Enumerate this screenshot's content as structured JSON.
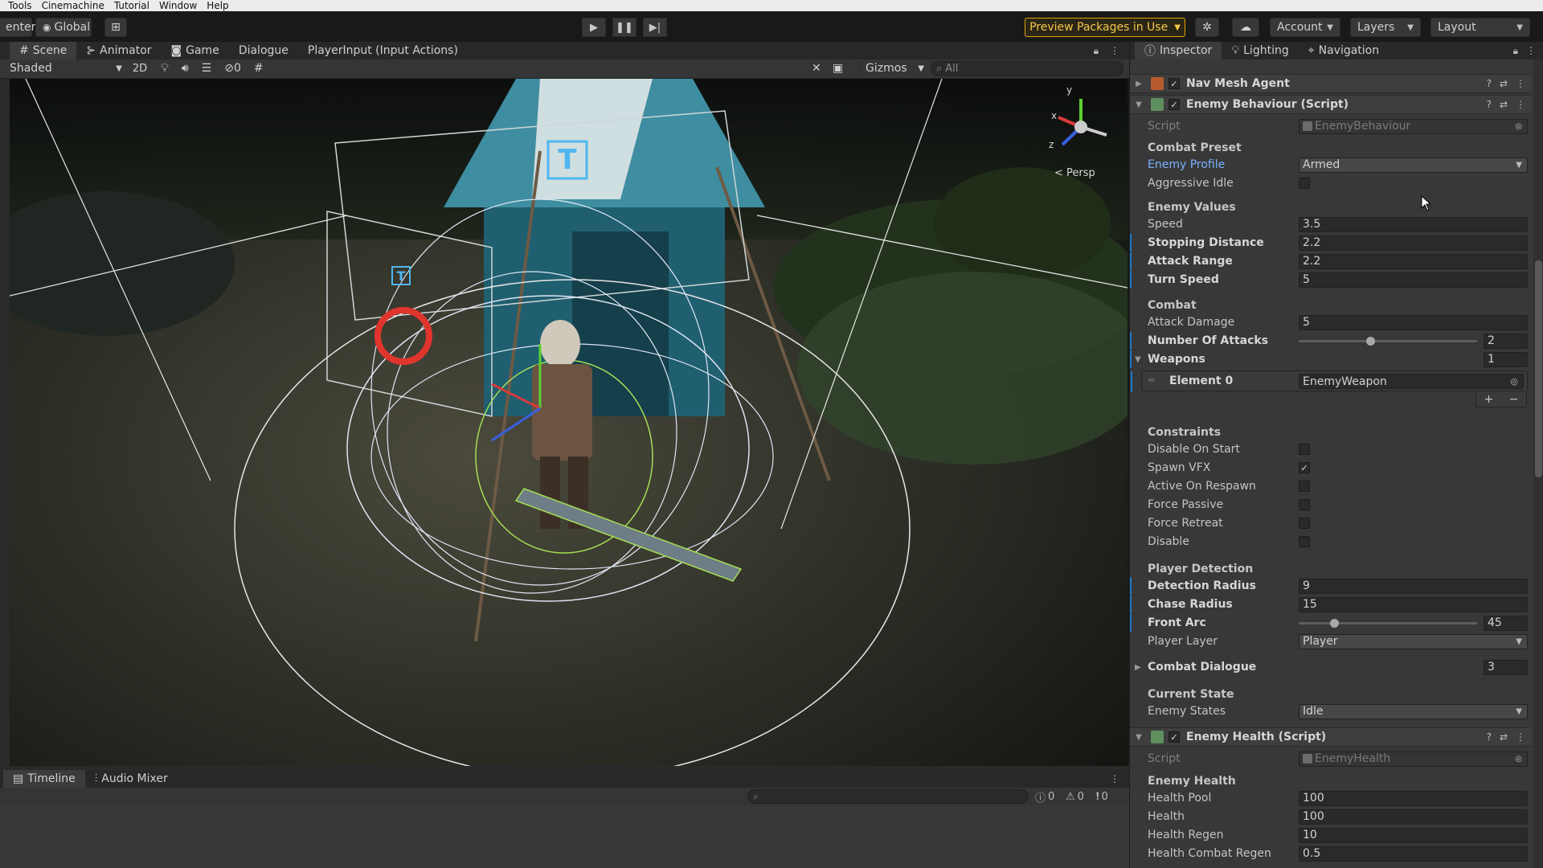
{
  "menu": [
    "Tools",
    "Cinemachine",
    "Tutorial",
    "Window",
    "Help"
  ],
  "toolbar": {
    "center_label": "enter",
    "global_label": "Global",
    "preview_label": "Preview Packages in Use",
    "account_label": "Account",
    "layers_label": "Layers",
    "layout_label": "Layout"
  },
  "scene_tabs": [
    "Scene",
    "Animator",
    "Game",
    "Dialogue",
    "PlayerInput (Input Actions)"
  ],
  "scene_toolbar": {
    "shading": "Shaded",
    "mode_2d": "2D",
    "hidden_count": "0",
    "gizmos": "Gizmos",
    "search_placeholder": "All"
  },
  "viewport": {
    "persp_label": "< Persp",
    "axis_x": "x",
    "axis_y": "y",
    "axis_z": "z"
  },
  "bottom_tabs": [
    "Timeline",
    "Audio Mixer"
  ],
  "console_counts": {
    "info": "0",
    "warn": "0",
    "error": "0"
  },
  "inspector_tabs": [
    "Inspector",
    "Lighting",
    "Navigation"
  ],
  "inspector": {
    "nav_mesh_agent": "Nav Mesh Agent",
    "enemy_behaviour": {
      "title": "Enemy Behaviour (Script)",
      "script_label": "Script",
      "script_value": "EnemyBehaviour",
      "combat_preset": "Combat Preset",
      "enemy_profile_label": "Enemy Profile",
      "enemy_profile_value": "Armed",
      "aggressive_idle": "Aggressive Idle",
      "enemy_values": "Enemy Values",
      "speed_label": "Speed",
      "speed_value": "3.5",
      "stopping_label": "Stopping Distance",
      "stopping_value": "2.2",
      "attack_range_label": "Attack Range",
      "attack_range_value": "2.2",
      "turn_speed_label": "Turn Speed",
      "turn_speed_value": "5",
      "combat": "Combat",
      "attack_damage_label": "Attack Damage",
      "attack_damage_value": "5",
      "num_attacks_label": "Number Of Attacks",
      "num_attacks_value": "2",
      "num_attacks_fraction": 0.4,
      "weapons_label": "Weapons",
      "weapons_count": "1",
      "element0_label": "Element 0",
      "element0_value": "EnemyWeapon",
      "constraints": "Constraints",
      "disable_on_start": "Disable On Start",
      "spawn_vfx": "Spawn VFX",
      "active_on_respawn": "Active On Respawn",
      "force_passive": "Force Passive",
      "force_retreat": "Force Retreat",
      "disable": "Disable",
      "player_detection": "Player Detection",
      "detection_radius_label": "Detection Radius",
      "detection_radius_value": "9",
      "chase_radius_label": "Chase Radius",
      "chase_radius_value": "15",
      "front_arc_label": "Front Arc",
      "front_arc_value": "45",
      "front_arc_fraction": 0.2,
      "player_layer_label": "Player Layer",
      "player_layer_value": "Player",
      "combat_dialogue_label": "Combat Dialogue",
      "combat_dialogue_count": "3",
      "current_state": "Current State",
      "enemy_states_label": "Enemy States",
      "enemy_states_value": "Idle"
    },
    "enemy_health": {
      "title": "Enemy Health (Script)",
      "script_label": "Script",
      "script_value": "EnemyHealth",
      "section": "Enemy Health",
      "health_pool_label": "Health Pool",
      "health_pool_value": "100",
      "health_label": "Health",
      "health_value": "100",
      "health_regen_label": "Health Regen",
      "health_regen_value": "10",
      "combat_regen_label": "Health Combat Regen",
      "combat_regen_value": "0.5"
    }
  }
}
